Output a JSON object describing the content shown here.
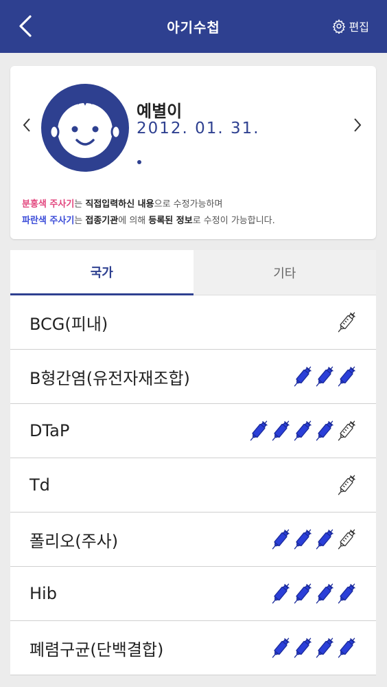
{
  "header": {
    "title": "아기수첩",
    "edit_label": "편집"
  },
  "profile": {
    "name": "예별이",
    "birth_date": "2012. 01. 31.",
    "notice": {
      "line1": {
        "pink_label": "분홍색 주사기",
        "t1": "는 ",
        "strong": "직접입력하신 내용",
        "t2": "으로 수정가능하며"
      },
      "line2": {
        "blue_label": "파란색 주사기",
        "t1": "는 ",
        "strong1": "접종기관",
        "t2": "에 의해 ",
        "strong2": "등록된 정보",
        "t3": "로 수정이 가능합니다."
      }
    }
  },
  "tabs": [
    {
      "label": "국가",
      "active": true
    },
    {
      "label": "기타",
      "active": false
    }
  ],
  "vaccines": [
    {
      "name": "BCG(피내)",
      "doses": [
        false
      ]
    },
    {
      "name": "B형간염(유전자재조합)",
      "doses": [
        true,
        true,
        true
      ]
    },
    {
      "name": "DTaP",
      "doses": [
        true,
        true,
        true,
        true,
        false
      ]
    },
    {
      "name": "Td",
      "doses": [
        false
      ]
    },
    {
      "name": "폴리오(주사)",
      "doses": [
        true,
        true,
        true,
        false
      ]
    },
    {
      "name": "Hib",
      "doses": [
        true,
        true,
        true,
        true
      ]
    },
    {
      "name": "폐렴구균(단백결합)",
      "doses": [
        true,
        true,
        true,
        true
      ]
    }
  ],
  "colors": {
    "primary": "#2e4090",
    "syringe_filled": "#2b3fd8",
    "syringe_empty": "#ffffff",
    "pink": "#e2457d"
  }
}
